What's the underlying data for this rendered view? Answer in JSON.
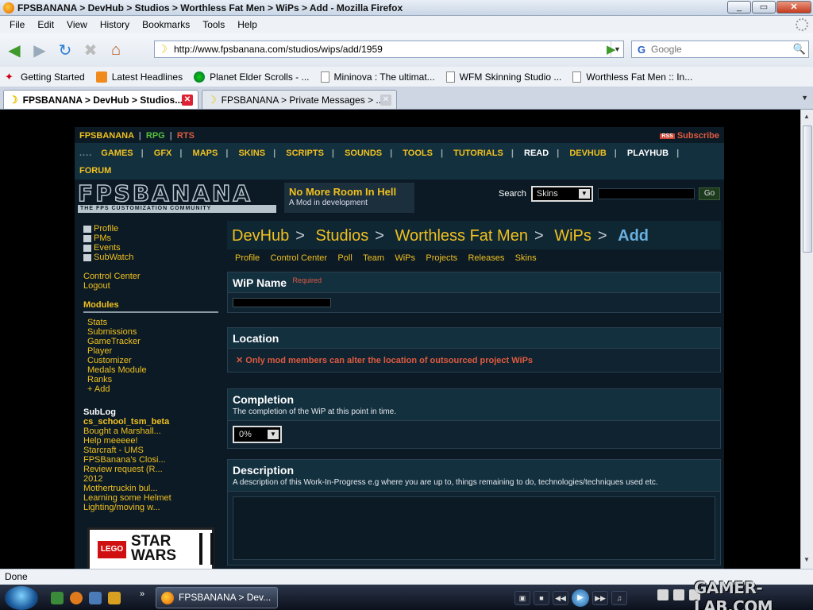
{
  "window": {
    "title": "FPSBANANA > DevHub > Studios > Worthless Fat Men > WiPs > Add - Mozilla Firefox",
    "controls": [
      "_",
      "▭",
      "✕"
    ]
  },
  "menu": [
    "File",
    "Edit",
    "View",
    "History",
    "Bookmarks",
    "Tools",
    "Help"
  ],
  "nav": {
    "url": "http://www.fpsbanana.com/studios/wips/add/1959",
    "search_placeholder": "Google"
  },
  "bookmarks": [
    {
      "label": "Getting Started",
      "icon": "firefox-red-icon"
    },
    {
      "label": "Latest Headlines",
      "icon": "rss-icon"
    },
    {
      "label": "Planet Elder Scrolls - ...",
      "icon": "green-circle-icon"
    },
    {
      "label": "Mininova : The ultimat...",
      "icon": "page-icon"
    },
    {
      "label": "WFM Skinning Studio ...",
      "icon": "page-icon"
    },
    {
      "label": "Worthless Fat Men :: In...",
      "icon": "page-icon"
    }
  ],
  "tabs": [
    {
      "label": "FPSBANANA > DevHub > Studios...",
      "active": true
    },
    {
      "label": "FPSBANANA > Private Messages > ...",
      "active": false
    }
  ],
  "site": {
    "brand": {
      "fps": "FPS",
      "banana": "BANANA",
      "rpg": "RPG",
      "rts": "RTS",
      "sep": "|"
    },
    "subscribe": "Subscribe",
    "rss_badge": "RSS",
    "nav_row1": [
      "GAMES",
      "GFX",
      "MAPS",
      "SKINS",
      "SCRIPTS",
      "SOUNDS",
      "TOOLS",
      "TUTORIALS",
      "READ",
      "DEVHUB",
      "PLAYHUB"
    ],
    "nav_row2": [
      "FORUM"
    ],
    "logo_text": "FPSBANANA",
    "logo_tagline": "THE FPS CUSTOMIZATION COMMUNITY",
    "promo": {
      "title": "No More Room In Hell",
      "subtitle": "A Mod in development"
    },
    "search": {
      "label": "Search",
      "selected": "Skins",
      "go": "Go"
    }
  },
  "sidebar": {
    "user_links": [
      "Profile",
      "PMs",
      "Events",
      "SubWatch"
    ],
    "account_links": [
      "Control Center",
      "Logout"
    ],
    "modules_heading": "Modules",
    "modules": [
      "Stats",
      "Submissions",
      "GameTracker",
      "Player",
      "Customizer",
      "Medals Module",
      "Ranks",
      "+ Add"
    ],
    "sublog_heading": "SubLog",
    "sublog": [
      "cs_school_tsm_beta",
      "Bought a Marshall...",
      "Help meeeee!",
      "Starcraft - UMS",
      "FPSBanana's Closi...",
      "Review request (R...",
      "2012",
      "Mothertruckin bul...",
      "Learning some Helmet",
      "Lighting/moving w..."
    ],
    "ad": {
      "lego": "LEGO",
      "title": "STAR WARS"
    }
  },
  "breadcrumb": {
    "items": [
      "DevHub",
      "Studios",
      "Worthless Fat Men",
      "WiPs"
    ],
    "current": "Add",
    "sep": ">"
  },
  "subnav": [
    "Profile",
    "Control Center",
    "Poll",
    "Team",
    "WiPs",
    "Projects",
    "Releases",
    "Skins"
  ],
  "form": {
    "wip_name": {
      "label": "WiP Name",
      "required": "Required"
    },
    "location": {
      "label": "Location",
      "error": "✕ Only mod members can alter the location of outsourced project WiPs"
    },
    "completion": {
      "label": "Completion",
      "help": "The completion of the WiP at this point in time.",
      "value": "0%"
    },
    "description": {
      "label": "Description",
      "help": "A description of this Work-In-Progress e.g where you are up to, things remaining to do, technologies/techniques used etc."
    }
  },
  "statusbar": "Done",
  "taskbar": {
    "window": "FPSBANANA > Dev..."
  },
  "watermark": "GAMER-LAB.COM"
}
